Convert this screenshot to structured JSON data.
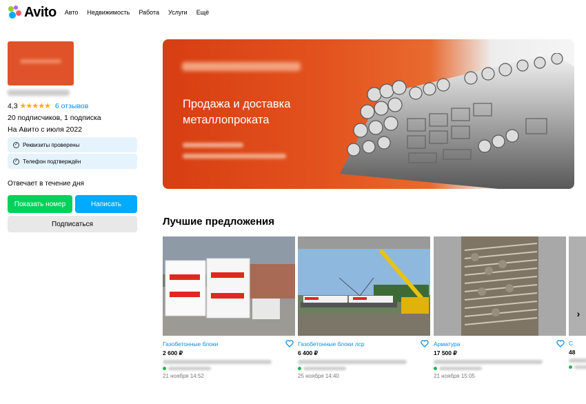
{
  "header": {
    "logo_text": "Avito",
    "nav": [
      "Авто",
      "Недвижимость",
      "Работа",
      "Услуги",
      "Ещё"
    ]
  },
  "seller": {
    "rating": "4,3",
    "stars": "★★★★★",
    "reviews": "6 отзывов",
    "subscriptions": "20 подписчиков, 1 подписка",
    "since": "На Авито с июля 2022",
    "badges": [
      "Реквизиты проверены",
      "Телефон подтверждён"
    ],
    "response": "Отвечает в течение дня",
    "show_phone": "Показать номер",
    "write": "Написать",
    "subscribe": "Подписаться"
  },
  "banner": {
    "line1": "Продажа и доставка",
    "line2": "металлопроката"
  },
  "offers": {
    "title": "Лучшие предложения",
    "cards": [
      {
        "title": "Газобетонные блоки",
        "price": "2 600 ₽",
        "date": "21 ноября 14:52"
      },
      {
        "title": "Газобетонные блоки лср",
        "price": "6 400 ₽",
        "date": "25 ноября 14:40"
      },
      {
        "title": "Арматура",
        "price": "17 500 ₽",
        "date": "21 ноября 15:05"
      },
      {
        "title": "С",
        "price": "48"
      }
    ]
  },
  "colors": {
    "green": "#02d15c",
    "blue": "#00aaff",
    "link": "#0a8ee0",
    "banner": "#e3531e",
    "star": "#f8b100"
  }
}
